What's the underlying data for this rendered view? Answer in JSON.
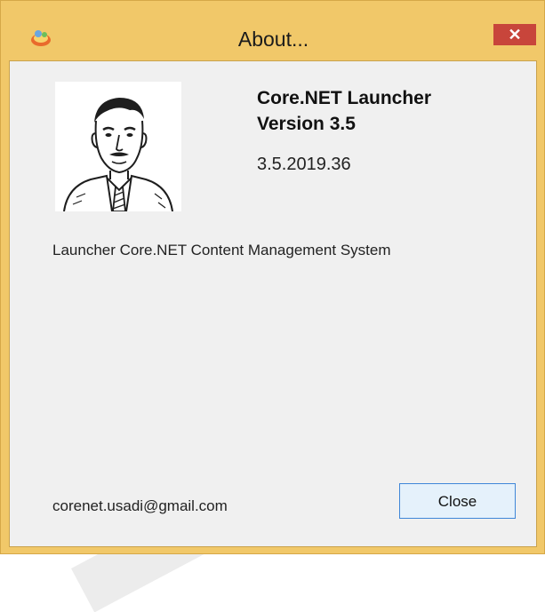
{
  "window": {
    "title": "About...",
    "close_glyph": "✕"
  },
  "about": {
    "product_name": "Core.NET Launcher",
    "product_version": "Version 3.5",
    "build_number": "3.5.2019.36",
    "description": "Launcher Core.NET Content Management System",
    "email": "corenet.usadi@gmail.com",
    "close_label": "Close"
  },
  "icons": {
    "app": "application-icon",
    "photo": "author-portrait"
  },
  "colors": {
    "titlebar": "#f1c869",
    "close_button": "#c8453b",
    "client_background": "#f0f0f0",
    "button_border": "#3f86d8"
  }
}
